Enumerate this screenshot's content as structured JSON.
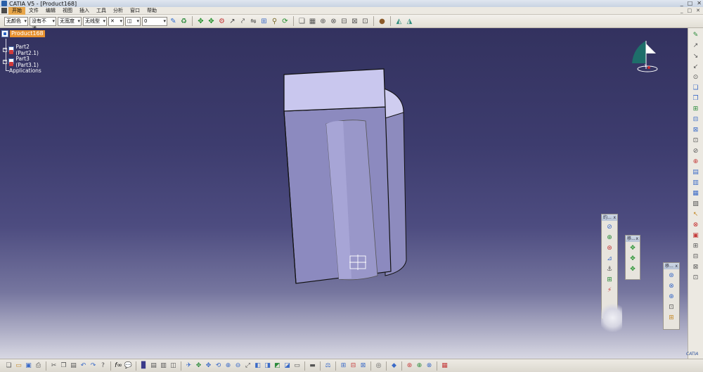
{
  "window": {
    "title": "CATIA V5 - [Product168]",
    "controls": [
      "_",
      "□",
      "✕"
    ]
  },
  "menu": {
    "items": [
      "开始",
      "文件",
      "编辑",
      "视图",
      "插入",
      "工具",
      "分析",
      "窗口",
      "帮助"
    ]
  },
  "toolbar": {
    "color_select": "无颜色",
    "transparency_select": "没有不透",
    "linetype_select": "无宽度",
    "lineweight_select": "无线型",
    "layer_value": "0"
  },
  "tree": {
    "root": "Product168",
    "children": [
      {
        "label": "Part2 (Part2.1)"
      },
      {
        "label": "Part3 (Part3.1)"
      }
    ],
    "applications": "Applications"
  },
  "floating_toolbars": [
    {
      "title": "约...",
      "close": "x"
    },
    {
      "title": "移...",
      "close": "x"
    },
    {
      "title": "移...",
      "close": "x"
    }
  ],
  "colors": {
    "tree_highlight": "#e8912f",
    "background_top": "#33325f",
    "background_bottom": "#d8d8e3",
    "part_face": "#8e8cc0",
    "part_top": "#c8c6ec"
  },
  "icons": {
    "compass": "compass-icon",
    "product": "product-icon",
    "part": "part-icon"
  },
  "branding": {
    "logo": "CATIA"
  }
}
